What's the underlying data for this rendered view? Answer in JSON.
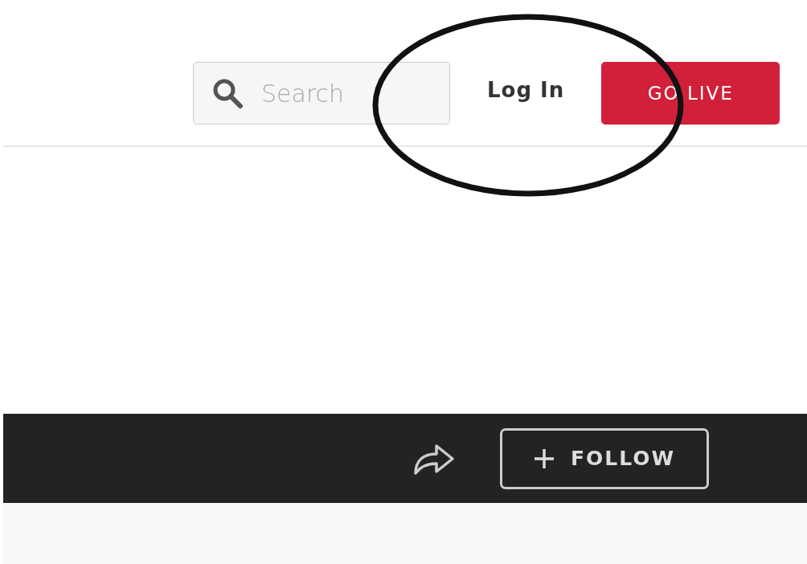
{
  "header": {
    "search": {
      "placeholder": "Search"
    },
    "login": "Log In",
    "go_live": "GO LIVE"
  },
  "toolbar": {
    "follow": "FOLLOW"
  }
}
